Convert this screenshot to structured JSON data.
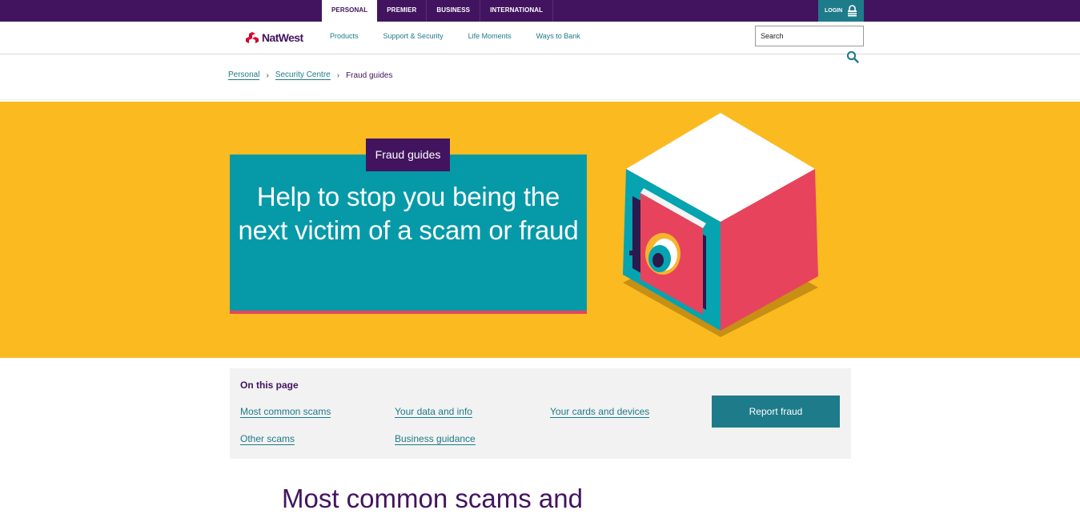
{
  "topbar": {
    "tabs": [
      "PERSONAL",
      "PREMIER",
      "BUSINESS",
      "INTERNATIONAL"
    ],
    "active_tab": "PERSONAL",
    "login_label": "LOGIN"
  },
  "nav": {
    "brand": "NatWest",
    "links": [
      "Products",
      "Support & Security",
      "Life Moments",
      "Ways to Bank"
    ],
    "search_placeholder": "Search"
  },
  "breadcrumb": {
    "items": [
      "Personal",
      "Security Centre"
    ],
    "current": "Fraud guides"
  },
  "hero": {
    "tag": "Fraud guides",
    "title": "Help to stop you being the next victim of a scam or fraud"
  },
  "on_this_page": {
    "title": "On this page",
    "links": [
      "Most common scams",
      "Your data and info",
      "Your cards and devices",
      "Other scams",
      "Business guidance"
    ],
    "report_button": "Report fraud"
  },
  "section": {
    "heading": "Most common scams and"
  },
  "colors": {
    "brand_purple": "#42145f",
    "teal": "#1d7b8a",
    "hero_yellow": "#fbba20",
    "card_teal": "#069aa8",
    "accent_pink": "#e8435d"
  }
}
